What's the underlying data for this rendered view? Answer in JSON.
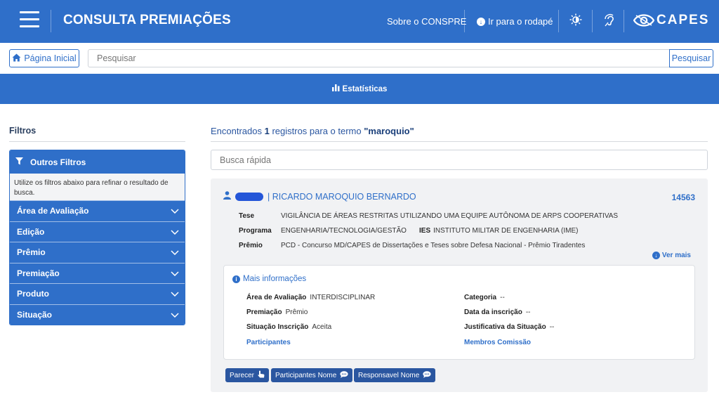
{
  "header": {
    "title": "CONSULTA PREMIAÇÕES",
    "about_link": "Sobre o CONSPRE",
    "footer_link": "Ir para o rodapé",
    "logo_text": "CAPES"
  },
  "search": {
    "home_label": "Página Inicial",
    "placeholder": "Pesquisar",
    "button_label": "Pesquisar"
  },
  "stats": {
    "label": "Estatísticas"
  },
  "sidebar": {
    "title": "Filtros",
    "box_title": "Outros Filtros",
    "help_text": "Utilize os filtros abaixo para refinar o resultado de busca.",
    "items": [
      {
        "label": "Área de Avaliação"
      },
      {
        "label": "Edição"
      },
      {
        "label": "Prêmio"
      },
      {
        "label": "Premiação"
      },
      {
        "label": "Produto"
      },
      {
        "label": "Situação"
      }
    ]
  },
  "results": {
    "prefix": "Encontrados ",
    "count": "1",
    "middle": " registros para o termo ",
    "term": "\"maroquio\"",
    "quick_search_placeholder": "Busca rápida"
  },
  "record": {
    "name": "| RICARDO MAROQUIO BERNARDO",
    "id": "14563",
    "tese_label": "Tese",
    "tese_value": "VIGILÂNCIA DE ÁREAS RESTRITAS UTILIZANDO UMA EQUIPE AUTÔNOMA DE ARPS COOPERATIVAS",
    "programa_label": "Programa",
    "programa_value": "ENGENHARIA/TECNOLOGIA/GESTÃO",
    "ies_label": "IES",
    "ies_value": "INSTITUTO MILITAR DE ENGENHARIA (IME)",
    "premio_label": "Prêmio",
    "premio_value": "PCD - Concurso MD/CAPES de Dissertações e Teses sobre Defesa Nacional - Prêmio Tiradentes",
    "ver_mais": "Ver mais"
  },
  "more_info": {
    "title": "Mais informações",
    "area_label": "Área de Avaliação",
    "area_value": "INTERDISCIPLINAR",
    "categoria_label": "Categoria",
    "categoria_value": "--",
    "premiacao_label": "Premiação",
    "premiacao_value": "Prêmio",
    "data_label": "Data da inscrição",
    "data_value": "--",
    "situacao_label": "Situação Inscrição",
    "situacao_value": "Aceita",
    "justificativa_label": "Justificativa da Situação",
    "justificativa_value": "--",
    "participantes_link": "Participantes",
    "membros_link": "Membros Comissão"
  },
  "actions": {
    "parecer": "Parecer",
    "participantes_nome": "Participantes Nome",
    "responsavel_nome": "Responsavel Nome"
  },
  "colors": {
    "primary": "#2f6fc9",
    "dark_button": "#2a56a0",
    "card_bg": "#f1f2f4"
  }
}
